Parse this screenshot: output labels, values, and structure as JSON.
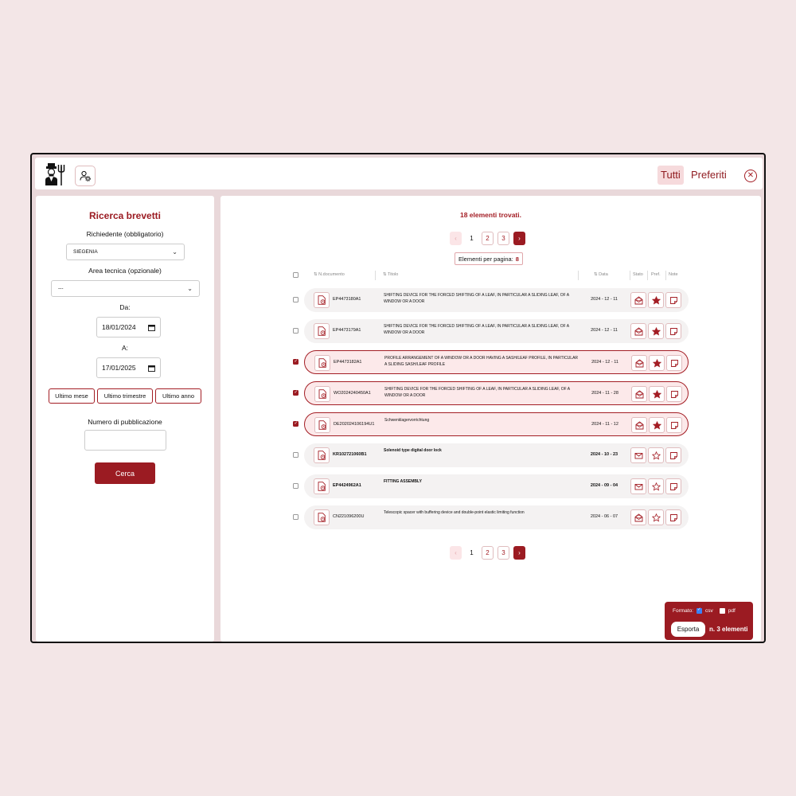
{
  "header": {
    "tabs": [
      {
        "label": "Tutti",
        "active": true
      },
      {
        "label": "Preferiti",
        "active": false
      }
    ],
    "logo_icon": "farmer-icon",
    "user_icon": "user-gear-icon",
    "close_icon": "close-circle-icon"
  },
  "sidebar": {
    "title": "Ricerca brevetti",
    "applicant_label": "Richiedente (obbligatorio)",
    "applicant_value": "SIEGENIA",
    "area_label": "Area tecnica (opzionale)",
    "area_value": "---",
    "from_label": "Da:",
    "from_value": "18/01/2024",
    "to_label": "A:",
    "to_value": "17/01/2025",
    "quick": [
      "Ultimo mese",
      "Ultimo trimestre",
      "Ultimo anno"
    ],
    "pub_label": "Numero di pubblicazione",
    "pub_value": "",
    "search_label": "Cerca"
  },
  "main": {
    "found_text": "18 elementi trovati.",
    "pagination": {
      "pages": [
        "1",
        "2",
        "3"
      ],
      "current": "1"
    },
    "per_page_label": "Elementi per pagina:",
    "per_page_value": "8",
    "columns": {
      "doc": "N.documento",
      "title": "Titolo",
      "date": "Data",
      "status": "Stato",
      "pref": "Pref.",
      "notes": "Note"
    },
    "rows": [
      {
        "num": "EP4473180A1",
        "title": "SHIFTING DEVICE FOR THE FORCED SHIFTING OF A LEAF, IN PARTICULAR A SLIDING LEAF, OF A WINDOW OR A DOOR",
        "date": "2024 - 12 - 11",
        "selected": false,
        "bold": false,
        "status_icon": "mail-open-icon",
        "fav": true
      },
      {
        "num": "EP4473179A1",
        "title": "SHIFTING DEVICE FOR THE FORCED SHIFTING OF A LEAF, IN PARTICULAR A SLIDING LEAF, OF A WINDOW OR A DOOR",
        "date": "2024 - 12 - 11",
        "selected": false,
        "bold": false,
        "status_icon": "mail-open-icon",
        "fav": true
      },
      {
        "num": "EP4473182A1",
        "title": "PROFILE ARRANGEMENT OF A WINDOW OR A DOOR HAVING A SASH/LEAF PROFILE, IN PARTICULAR A SLIDING SASH/LEAF PROFILE",
        "date": "2024 - 12 - 11",
        "selected": true,
        "bold": false,
        "status_icon": "mail-open-icon",
        "fav": true
      },
      {
        "num": "WO2024240450A1",
        "title": "SHIFTING DEVICE FOR THE FORCED SHIFTING OF A LEAF, IN PARTICULAR A SLIDING LEAF, OF A WINDOW OR A DOOR",
        "date": "2024 - 11 - 28",
        "selected": true,
        "bold": false,
        "status_icon": "mail-open-icon",
        "fav": true
      },
      {
        "num": "DE202024106194U1",
        "title": "Schwenklagervorrichtung",
        "date": "2024 - 11 - 12",
        "selected": true,
        "bold": false,
        "status_icon": "mail-open-icon",
        "fav": true
      },
      {
        "num": "KR102721060B1",
        "title": "Solenoid type digital door lock",
        "date": "2024 - 10 - 23",
        "selected": false,
        "bold": true,
        "status_icon": "mail-closed-icon",
        "fav": false
      },
      {
        "num": "EP4424962A1",
        "title": "FITTING ASSEMBLY",
        "date": "2024 - 09 - 04",
        "selected": false,
        "bold": true,
        "status_icon": "mail-closed-icon",
        "fav": false
      },
      {
        "num": "CN221096200U",
        "title": "Telescopic spacer with buffering device and double-point elastic limiting function",
        "date": "2024 - 06 - 07",
        "selected": false,
        "bold": false,
        "status_icon": "mail-open-icon",
        "fav": false
      }
    ],
    "export": {
      "format_label": "Formato:",
      "csv_label": "csv",
      "pdf_label": "pdf",
      "csv_checked": true,
      "pdf_checked": false,
      "button_label": "Esporta",
      "count_text": "n. 3 elementi"
    }
  },
  "colors": {
    "accent": "#9b1b22",
    "background": "#f3e6e7",
    "selected_row": "#fce9ea"
  }
}
